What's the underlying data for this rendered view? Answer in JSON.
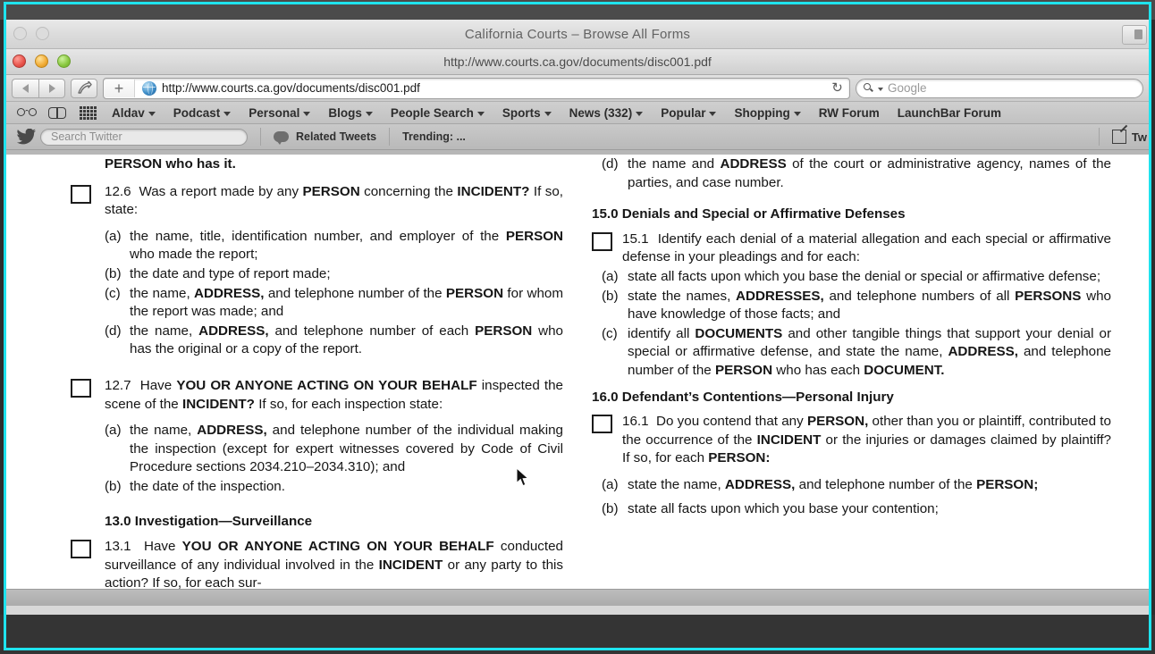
{
  "window": {
    "background_title": "California Courts – Browse All Forms",
    "active_title": "http://www.courts.ca.gov/documents/disc001.pdf"
  },
  "toolbar": {
    "back_icon": "back-arrow-icon",
    "forward_icon": "forward-arrow-icon",
    "share_icon": "share-icon",
    "new_tab_label": "+",
    "address_value": "http://www.courts.ca.gov/documents/disc001.pdf",
    "reload_glyph": "↻",
    "search_placeholder": "Google",
    "search_engine_label": "Google"
  },
  "bookmarks_bar": {
    "icons": [
      "reader-glasses-icon",
      "bookmarks-book-icon",
      "top-sites-grid-icon"
    ],
    "items": [
      {
        "label": "Aldav",
        "has_menu": true
      },
      {
        "label": "Podcast",
        "has_menu": true
      },
      {
        "label": "Personal",
        "has_menu": true
      },
      {
        "label": "Blogs",
        "has_menu": true
      },
      {
        "label": "People Search",
        "has_menu": true
      },
      {
        "label": "Sports",
        "has_menu": true
      },
      {
        "label": "News (332)",
        "has_menu": true
      },
      {
        "label": "Popular",
        "has_menu": true
      },
      {
        "label": "Shopping",
        "has_menu": true
      },
      {
        "label": "RW Forum",
        "has_menu": false
      },
      {
        "label": "LaunchBar Forum",
        "has_menu": false
      }
    ]
  },
  "twitter_bar": {
    "bird_icon": "twitter-bird-icon",
    "search_placeholder": "Search Twitter",
    "related_tweets_label": "Related Tweets",
    "trending_label": "Trending: ...",
    "compose_label": "Tw"
  },
  "document": {
    "left_column": {
      "orphan_line": "PERSON who has it.",
      "q126": {
        "number": "12.6",
        "text_1": "Was a report made by any ",
        "bold_1": "PERSON",
        "text_2": " concerning the ",
        "bold_2": "INCIDENT?",
        "text_3": " If so, state:",
        "items": [
          {
            "label": "(a)",
            "line1": "the name, title, identification number, and employer of",
            "line2_pre": "the ",
            "line2_bold": "PERSON",
            "line2_post": " who made the report;"
          },
          {
            "label": "(b)",
            "line1": "the date and type of report made;",
            "line2_pre": "",
            "line2_bold": "",
            "line2_post": ""
          },
          {
            "label": "(c)",
            "line1_pre": "the name, ",
            "line1_bold": "ADDRESS,",
            "line1_post": " and telephone  number of  the",
            "line2_bold": "PERSON",
            "line2_post": " for whom the report was made; and"
          },
          {
            "label": "(d)",
            "line1_pre": "the name, ",
            "line1_bold": "ADDRESS,",
            "line1_post": " and  telephone  number of each",
            "line2_bold": "PERSON",
            "line2_post": " who has the original or a copy of the report."
          }
        ]
      },
      "q127": {
        "number": "12.7",
        "text_1": "Have ",
        "bold_1": "YOU OR ANYONE ACTING ON YOUR BEHALF",
        "text_2": " inspected the scene of the ",
        "bold_2": "INCIDENT?",
        "text_3": " If so, for each inspection state:",
        "items": [
          {
            "label": "(a)",
            "pre": "the name, ",
            "bold": "ADDRESS,",
            "post": " and telephone  number of  the individual  making  the  inspection  (except  for  expert witnesses  covered    by    Code   of    Civil    Procedure sections 2034.210–2034.310); and"
          },
          {
            "label": "(b)",
            "pre": "the date of the inspection.",
            "bold": "",
            "post": ""
          }
        ]
      },
      "section13": {
        "heading": "13.0  Investigation—Surveillance",
        "q131": {
          "number": "13.1",
          "text_1": "Have ",
          "bold_1": "YOU OR ANYONE ACTING ON YOUR BEHALF",
          "text_2": " conducted  surveillance  of  any  individual  involved  in  the ",
          "bold_2": "INCIDENT",
          "text_3": " or any party to this action? If so, for each sur-"
        }
      }
    },
    "right_column": {
      "item_d": {
        "label": "(d)",
        "pre": "the name and ",
        "bold": "ADDRESS",
        "post": " of the court or administrative agency, names of the parties, and case number."
      },
      "section15": {
        "heading": "15.0 Denials and Special or Affirmative Defenses",
        "q151": {
          "number": "15.1",
          "text": "Identify each denial of a  material  allegation and each special  or  affirmative  defense  in  your  pleadings  and  for each:",
          "items": [
            {
              "label": "(a)",
              "pre": "state all facts upon which you base the denial  or special or affirmative defense;",
              "bold": "",
              "post": ""
            },
            {
              "label": "(b)",
              "pre": "state the names, ",
              "bold": "ADDRESSES,",
              "post": " and telephone numbers",
              "bold2": "PERSONS",
              "post2": " who  have  knowledge  of  those facts; and",
              "pre2": "of all  "
            },
            {
              "label": "(c)",
              "pre": "identify all ",
              "bold": "DOCUMENTS",
              "post": " and other  tangible  things that support your denial or special or affirmative defense, and state  the  name,  ",
              "bold2": "ADDRESS,",
              "post2": "  and  telephone  number  of the ",
              "bold3": "PERSON",
              "post3": " who has each ",
              "bold4": "DOCUMENT."
            }
          ]
        }
      },
      "section16": {
        "heading": "16.0  Defendant’s Contentions—Personal Injury",
        "q161": {
          "number": "16.1",
          "text_1": "Do you contend that any ",
          "bold_1": "PERSON,",
          "text_2": " other than you or plaintiff,  contributed  to  the  occurrence  of  the ",
          "bold_2": "INCIDENT",
          "text_3": " or the  injuries  or  damages  claimed  by  plaintiff?  If  so,  for  each ",
          "bold_3": "PERSON:",
          "items": [
            {
              "label": "(a)",
              "pre": "state the name, ",
              "bold": "ADDRESS,",
              "post": "  and  telephone  number  of the ",
              "bold2": "PERSON;"
            },
            {
              "label": "(b)",
              "pre": "state all facts upon which you base your contention;",
              "bold": "",
              "post": ""
            }
          ]
        }
      }
    }
  },
  "colors": {
    "frame_accent": "#1fe3ee",
    "chrome_gray": "#cdcdcd",
    "page_white": "#ffffff",
    "text_black": "#161616"
  }
}
